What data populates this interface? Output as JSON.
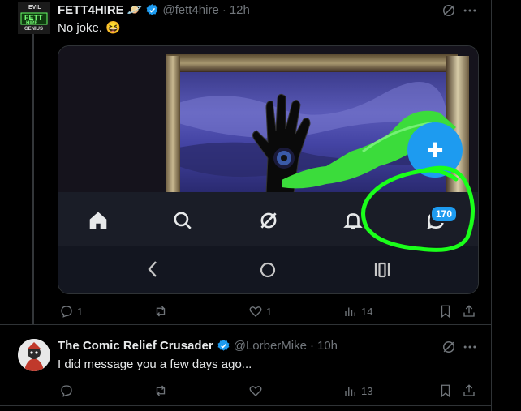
{
  "tweet1": {
    "author_name": "FETT4HIRE",
    "author_emoji": "🪐",
    "handle": "@fett4hire",
    "sep": "·",
    "time": "12h",
    "text": "No joke. 😆",
    "avatar_text": [
      "EVIL",
      "FETT",
      "HIRE",
      "GENIUS"
    ],
    "media": {
      "fab_label": "+",
      "messages_badge": "170"
    },
    "actions": {
      "replies": "1",
      "reposts": "",
      "likes": "1",
      "views": "14"
    }
  },
  "tweet2": {
    "author_name": "The Comic Relief Crusader",
    "handle": "@LorberMike",
    "sep": "·",
    "time": "10h",
    "text": "I did message you a few days ago...",
    "actions": {
      "replies": "",
      "reposts": "",
      "likes": "",
      "views": "13"
    }
  },
  "colors": {
    "accent": "#1d9bf0",
    "annotation_green": "#1aff1a",
    "muted": "#71767b"
  }
}
